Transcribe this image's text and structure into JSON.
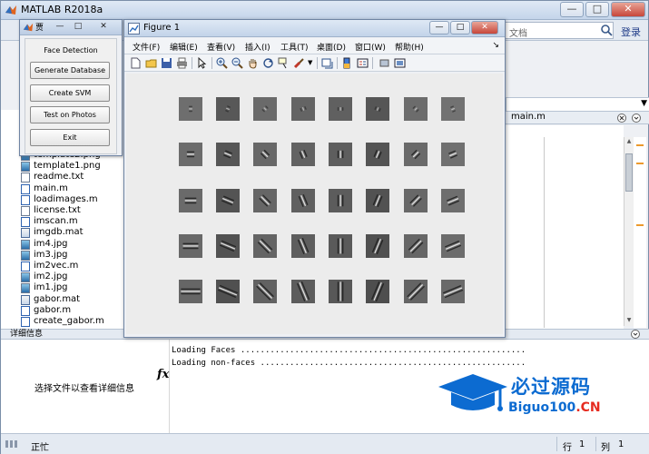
{
  "main_window": {
    "title": "MATLAB R2018a",
    "minimize": "—",
    "maximize": "□",
    "close": "✕"
  },
  "ribbon": {
    "search_placeholder": "文档",
    "login": "登录"
  },
  "editor": {
    "tab_label": "main.m"
  },
  "folder": {
    "files": [
      {
        "name": "template2.png",
        "type": "img"
      },
      {
        "name": "template1.png",
        "type": "img"
      },
      {
        "name": "readme.txt",
        "type": "txt"
      },
      {
        "name": "main.m",
        "type": "m"
      },
      {
        "name": "loadimages.m",
        "type": "m"
      },
      {
        "name": "license.txt",
        "type": "txt"
      },
      {
        "name": "imscan.m",
        "type": "m"
      },
      {
        "name": "imgdb.mat",
        "type": "mat"
      },
      {
        "name": "im4.jpg",
        "type": "img"
      },
      {
        "name": "im3.jpg",
        "type": "img"
      },
      {
        "name": "im2vec.m",
        "type": "m"
      },
      {
        "name": "im2.jpg",
        "type": "img"
      },
      {
        "name": "im1.jpg",
        "type": "img"
      },
      {
        "name": "gabor.mat",
        "type": "mat"
      },
      {
        "name": "gabor.m",
        "type": "m"
      },
      {
        "name": "create_gabor.m",
        "type": "m"
      }
    ]
  },
  "details": {
    "title": "详细信息",
    "message": "选择文件以查看详细信息"
  },
  "command_window": {
    "prompt_symbol": "fx",
    "lines": [
      "Loading Faces ..........................................................",
      "Loading non-faces ......................................................"
    ]
  },
  "status": {
    "text": "正忙",
    "row_label": "行",
    "row_value": "1",
    "col_label": "列",
    "col_value": "1"
  },
  "gui": {
    "title": "贾",
    "heading": "Face Detection",
    "buttons": [
      "Generate Database",
      "Create SVM",
      "Test on Photos",
      "Exit"
    ],
    "minimize": "—",
    "maximize": "□",
    "close": "✕"
  },
  "figure": {
    "title": "Figure 1",
    "minimize": "—",
    "maximize": "□",
    "close": "✕",
    "menus": [
      "文件(F)",
      "编辑(E)",
      "查看(V)",
      "插入(I)",
      "工具(T)",
      "桌面(D)",
      "窗口(W)",
      "帮助(H)"
    ],
    "dock_arrow": "↘",
    "toolbar_icons": [
      "new-figure-icon",
      "open-file-icon",
      "save-icon",
      "print-icon",
      "pointer-icon",
      "zoom-in-icon",
      "zoom-out-icon",
      "pan-icon",
      "rotate-icon",
      "data-cursor-icon",
      "brush-icon",
      "link-plot-icon",
      "insert-colorbar-icon",
      "insert-legend-icon",
      "hide-plot-tools-icon",
      "show-plot-tools-icon"
    ],
    "gabor_grid": {
      "rows": 5,
      "cols": 8
    }
  },
  "watermark": {
    "main": "必过源码",
    "url_prefix": "Biguo100",
    "url_suffix": ".CN"
  },
  "colors": {
    "accent": "#0c6bd1",
    "watermark_red": "#e62b20",
    "editor_marks": "#ec9a2d"
  }
}
